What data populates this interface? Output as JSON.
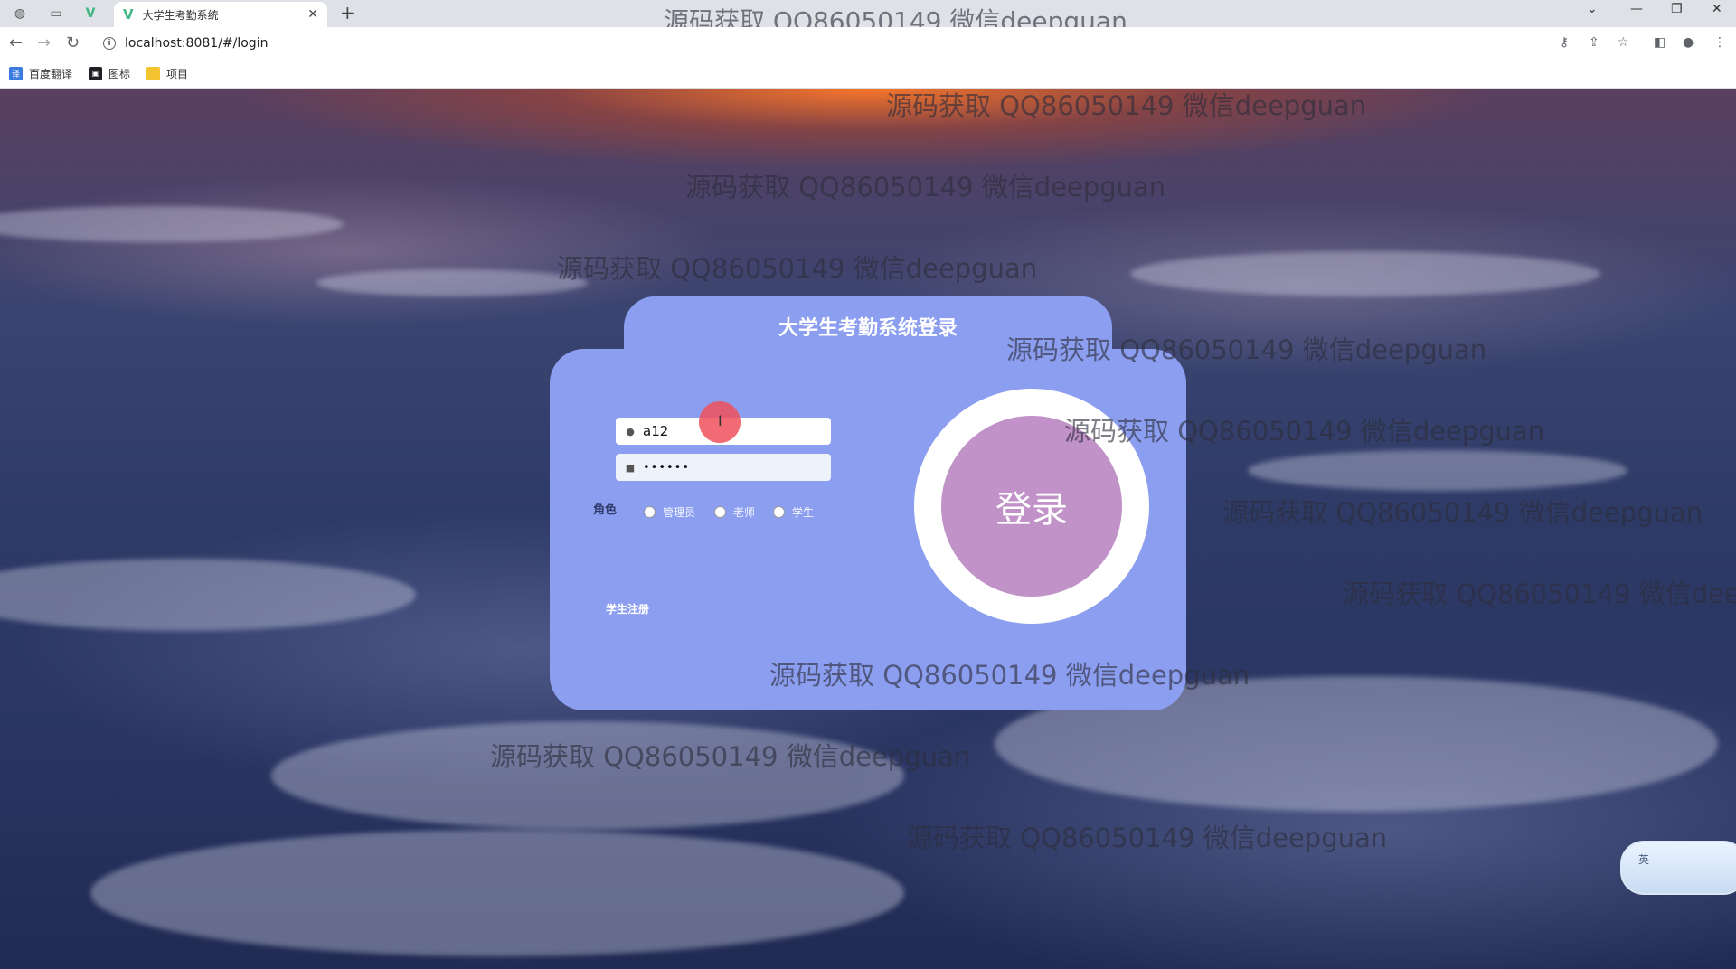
{
  "browser": {
    "tab_title": "大学生考勤系统",
    "tab_close": "✕",
    "new_tab": "+",
    "url": "localhost:8081/#/login",
    "window_title_watermark": "源码获取 QQ86050149 微信deepguan",
    "bookmarks": [
      {
        "label": "百度翻译",
        "icon": "translate-icon",
        "color": "#3a7be0"
      },
      {
        "label": "图标",
        "icon": "image-icon",
        "color": "#202124"
      },
      {
        "label": "项目",
        "icon": "folder-icon",
        "color": "#f4c430"
      }
    ]
  },
  "watermark_text": "源码获取 QQ86050149 微信deepguan",
  "login": {
    "title": "大学生考勤系统登录",
    "username_value": "a12",
    "password_value": "••••••",
    "role_label": "角色",
    "roles": [
      "管理员",
      "老师",
      "学生"
    ],
    "register_link": "学生注册",
    "login_button": "登录"
  },
  "ime": {
    "label": "英"
  },
  "colors": {
    "card": "#8c9ef0",
    "login_button": "#c092c8",
    "ring": "#ffffff"
  }
}
